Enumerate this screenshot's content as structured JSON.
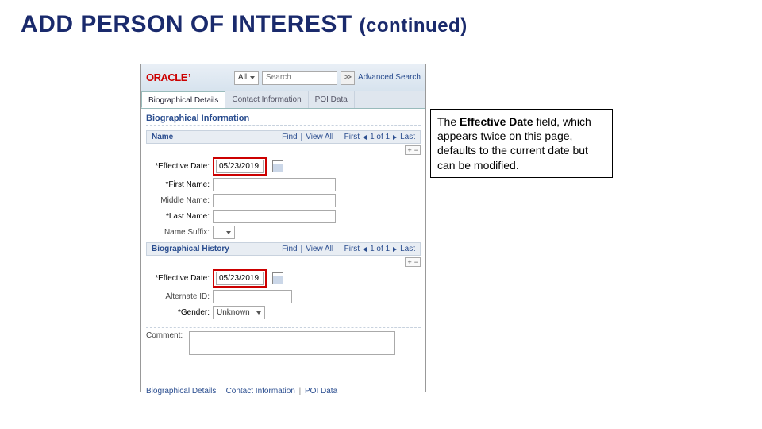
{
  "slide": {
    "title_main": "ADD PERSON OF INTEREST",
    "title_cont": "(continued)"
  },
  "callout": {
    "pre": "The ",
    "bold": "Effective Date",
    "post": " field, which appears twice on this page, defaults to the current date but can be modified."
  },
  "topbar": {
    "logo": "ORACLE",
    "logo_dot": "’",
    "dd_label": "All",
    "search_placeholder": "Search",
    "go_glyph": "≫",
    "advanced": "Advanced Search"
  },
  "tabs": {
    "t1": "Biographical Details",
    "t2": "Contact Information",
    "t3": "POI Data"
  },
  "section": {
    "bio_info": "Biographical Information",
    "name_group": "Name",
    "bio_history": "Biographical History"
  },
  "navstrip": {
    "find": "Find",
    "viewall": "View All",
    "first": "First",
    "count": "1 of 1",
    "last": "Last",
    "plus": "+",
    "minus": "−",
    "pipe": "|"
  },
  "labels": {
    "eff_date": "*Effective Date:",
    "first_name": "*First Name:",
    "middle_name": "Middle Name:",
    "last_name": "*Last Name:",
    "name_suffix": "Name Suffix:",
    "alternate_id": "Alternate ID:",
    "gender": "*Gender:",
    "comment": "Comment:"
  },
  "values": {
    "eff_date": "05/23/2019",
    "gender": "Unknown"
  },
  "footer": {
    "l1": "Biographical Details",
    "l2": "Contact Information",
    "l3": "POI Data",
    "sep": "|"
  }
}
